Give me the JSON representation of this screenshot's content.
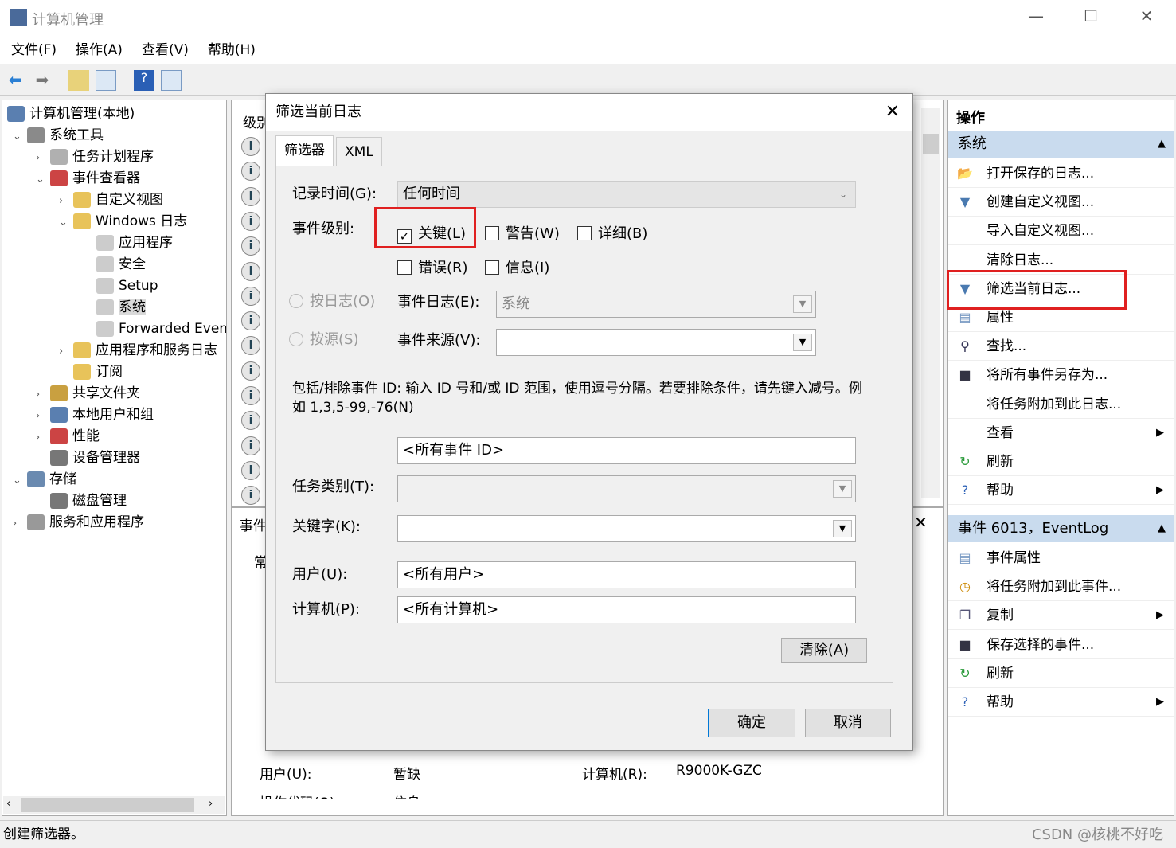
{
  "window": {
    "title": "计算机管理",
    "minimize": "—",
    "maximize": "☐",
    "close": "✕"
  },
  "menu": [
    "文件(F)",
    "操作(A)",
    "查看(V)",
    "帮助(H)"
  ],
  "tree": [
    {
      "label": "计算机管理(本地)",
      "level": 0,
      "arrow": ""
    },
    {
      "label": "系统工具",
      "level": 1,
      "arrow": "⌄"
    },
    {
      "label": "任务计划程序",
      "level": 2,
      "arrow": "›"
    },
    {
      "label": "事件查看器",
      "level": 2,
      "arrow": "⌄"
    },
    {
      "label": "自定义视图",
      "level": 3,
      "arrow": "›"
    },
    {
      "label": "Windows 日志",
      "level": 3,
      "arrow": "⌄"
    },
    {
      "label": "应用程序",
      "level": 4,
      "arrow": ""
    },
    {
      "label": "安全",
      "level": 4,
      "arrow": ""
    },
    {
      "label": "Setup",
      "level": 4,
      "arrow": ""
    },
    {
      "label": "系统",
      "level": 4,
      "arrow": "",
      "selected": true
    },
    {
      "label": "Forwarded Even",
      "level": 4,
      "arrow": ""
    },
    {
      "label": "应用程序和服务日志",
      "level": 3,
      "arrow": "›"
    },
    {
      "label": "订阅",
      "level": 3,
      "arrow": ""
    },
    {
      "label": "共享文件夹",
      "level": 2,
      "arrow": "›"
    },
    {
      "label": "本地用户和组",
      "level": 2,
      "arrow": "›"
    },
    {
      "label": "性能",
      "level": 2,
      "arrow": "›"
    },
    {
      "label": "设备管理器",
      "level": 2,
      "arrow": ""
    },
    {
      "label": "存储",
      "level": 1,
      "arrow": "⌄"
    },
    {
      "label": "磁盘管理",
      "level": 2,
      "arrow": ""
    },
    {
      "label": "服务和应用程序",
      "level": 1,
      "arrow": "›"
    }
  ],
  "middle": {
    "level_header": "级别",
    "detail_header": "事件",
    "general_tab": "常",
    "user_label": "用户(U):",
    "user_value": "暂缺",
    "computer_label": "计算机(R):",
    "computer_value": "R9000K-GZC",
    "opcode_label": "操作代码(O):",
    "opcode_value": "信息",
    "info_icon": "i"
  },
  "actions": {
    "title": "操作",
    "section1": "系统",
    "items1": [
      {
        "label": "打开保存的日志...",
        "icon": "folder-open"
      },
      {
        "label": "创建自定义视图...",
        "icon": "filter"
      },
      {
        "label": "导入自定义视图...",
        "icon": ""
      },
      {
        "label": "清除日志...",
        "icon": ""
      },
      {
        "label": "筛选当前日志...",
        "icon": "filter"
      },
      {
        "label": "属性",
        "icon": "properties"
      },
      {
        "label": "查找...",
        "icon": "binoculars"
      },
      {
        "label": "将所有事件另存为...",
        "icon": "save"
      },
      {
        "label": "将任务附加到此日志...",
        "icon": ""
      },
      {
        "label": "查看",
        "icon": "",
        "submenu": true
      },
      {
        "label": "刷新",
        "icon": "refresh"
      },
      {
        "label": "帮助",
        "icon": "help",
        "submenu": true
      }
    ],
    "section2": "事件 6013，EventLog",
    "items2": [
      {
        "label": "事件属性",
        "icon": "properties"
      },
      {
        "label": "将任务附加到此事件...",
        "icon": "clock"
      },
      {
        "label": "复制",
        "icon": "copy",
        "submenu": true
      },
      {
        "label": "保存选择的事件...",
        "icon": "save"
      },
      {
        "label": "刷新",
        "icon": "refresh"
      },
      {
        "label": "帮助",
        "icon": "help",
        "submenu": true
      }
    ]
  },
  "dialog": {
    "title": "筛选当前日志",
    "tabs": [
      "筛选器",
      "XML"
    ],
    "logged_label": "记录时间(G):",
    "logged_value": "任何时间",
    "level_label": "事件级别:",
    "levels": [
      {
        "label": "关键(L)",
        "checked": true
      },
      {
        "label": "警告(W)",
        "checked": false
      },
      {
        "label": "详细(B)",
        "checked": false
      },
      {
        "label": "错误(R)",
        "checked": false
      },
      {
        "label": "信息(I)",
        "checked": false
      }
    ],
    "by_log": "按日志(O)",
    "by_source": "按源(S)",
    "event_log_label": "事件日志(E):",
    "event_log_value": "系统",
    "event_source_label": "事件来源(V):",
    "event_source_value": "",
    "id_hint": "包括/排除事件 ID: 输入 ID 号和/或 ID 范围，使用逗号分隔。若要排除条件，请先键入减号。例如 1,3,5-99,-76(N)",
    "id_value": "<所有事件 ID>",
    "task_label": "任务类别(T):",
    "keywords_label": "关键字(K):",
    "user_label": "用户(U):",
    "user_value": "<所有用户>",
    "computer_label": "计算机(P):",
    "computer_value": "<所有计算机>",
    "clear": "清除(A)",
    "ok": "确定",
    "cancel": "取消"
  },
  "status": "创建筛选器。",
  "watermark": "CSDN @核桃不好吃",
  "colors": {
    "highlight": "#e02020",
    "section_bg": "#c9dbee",
    "ok_border": "#0078d7"
  }
}
